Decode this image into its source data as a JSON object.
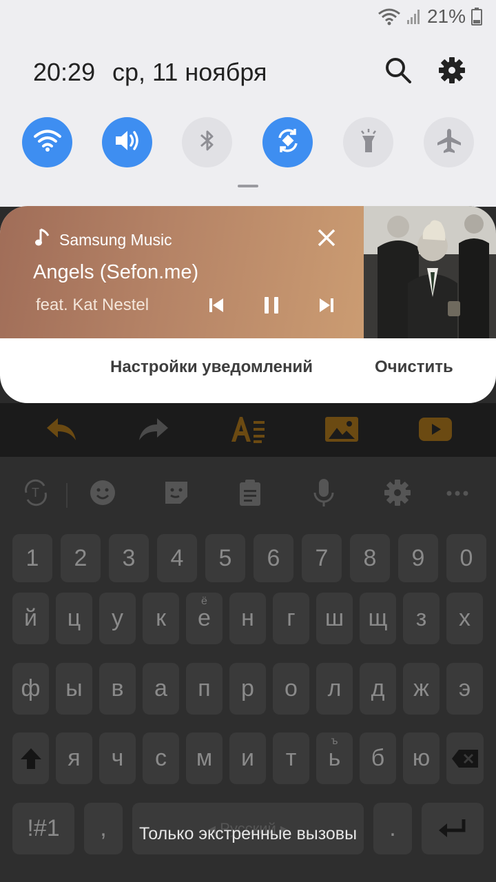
{
  "status_bar": {
    "battery": "21%"
  },
  "header": {
    "time": "20:29",
    "date": "ср, 11 ноября"
  },
  "quick_settings": [
    {
      "name": "wifi",
      "active": true
    },
    {
      "name": "sound",
      "active": true
    },
    {
      "name": "bluetooth",
      "active": false
    },
    {
      "name": "auto-rotate",
      "active": true
    },
    {
      "name": "flashlight",
      "active": false
    },
    {
      "name": "airplane-mode",
      "active": false
    }
  ],
  "media": {
    "app_name": "Samsung Music",
    "song_title": "Angels (Sefon.me)",
    "artist": "feat. Kat Nestel"
  },
  "notification_actions": {
    "settings_label": "Настройки уведомлений",
    "clear_label": "Очистить"
  },
  "keyboard": {
    "number_row": [
      "1",
      "2",
      "3",
      "4",
      "5",
      "6",
      "7",
      "8",
      "9",
      "0"
    ],
    "row1": [
      "й",
      "ц",
      "у",
      "к",
      "е",
      "н",
      "г",
      "ш",
      "щ",
      "з",
      "х"
    ],
    "row1_alt": {
      "е": "ё"
    },
    "row2": [
      "ф",
      "ы",
      "в",
      "а",
      "п",
      "р",
      "о",
      "л",
      "д",
      "ж",
      "э"
    ],
    "row3": [
      "я",
      "ч",
      "с",
      "м",
      "и",
      "т",
      "ь",
      "б",
      "ю"
    ],
    "row3_alt": {
      "ь": "ъ"
    },
    "symbols_label": "!#1",
    "comma_label": ",",
    "space_label": "◂ Русский ▸",
    "period_label": "."
  },
  "toast": "Только экстренные вызовы",
  "colors": {
    "accent": "#3e8ef1",
    "shade_bg": "#eeeef1",
    "toolbar_icon": "#6b4a12"
  }
}
